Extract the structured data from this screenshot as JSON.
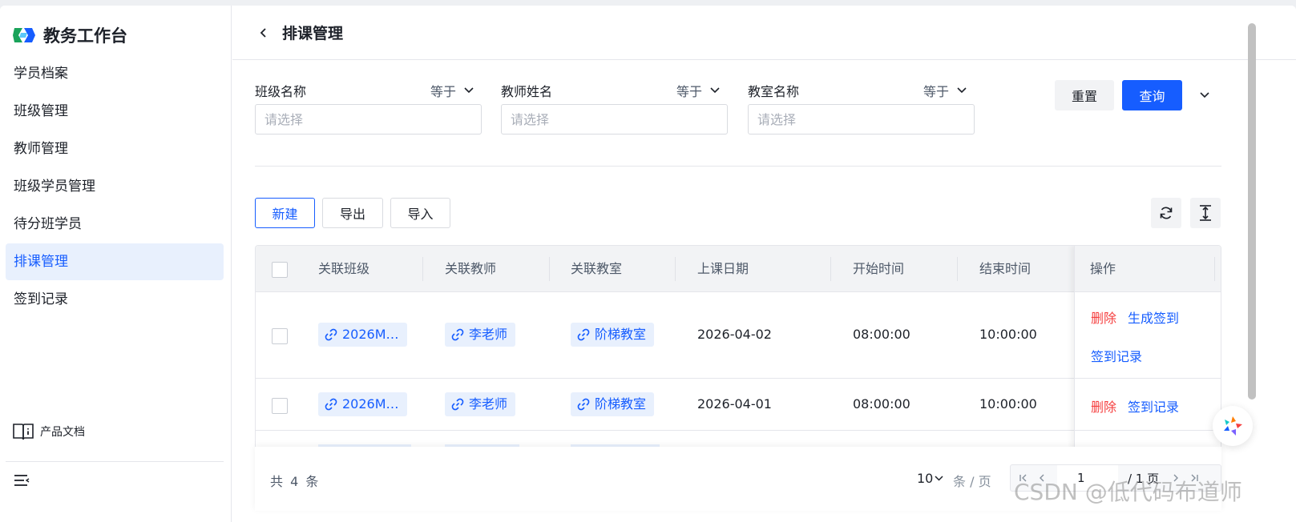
{
  "sidebar": {
    "brand": "教务工作台",
    "items": [
      {
        "label": "学员档案"
      },
      {
        "label": "班级管理"
      },
      {
        "label": "教师管理"
      },
      {
        "label": "班级学员管理"
      },
      {
        "label": "待分班学员"
      },
      {
        "label": "排课管理",
        "active": true
      },
      {
        "label": "签到记录"
      }
    ],
    "docs": "产品文档"
  },
  "header": {
    "title": "排课管理"
  },
  "filters": [
    {
      "label": "班级名称",
      "operator": "等于",
      "placeholder": "请选择"
    },
    {
      "label": "教师姓名",
      "operator": "等于",
      "placeholder": "请选择"
    },
    {
      "label": "教室名称",
      "operator": "等于",
      "placeholder": "请选择"
    }
  ],
  "actions": {
    "reset": "重置",
    "query": "查询"
  },
  "toolbar": {
    "new": "新建",
    "export": "导出",
    "import": "导入"
  },
  "table": {
    "columns": [
      "关联班级",
      "关联教师",
      "关联教室",
      "上课日期",
      "开始时间",
      "结束时间",
      "操作"
    ],
    "rows": [
      {
        "class": "2026M…",
        "teacher": "李老师",
        "room": "阶梯教室",
        "date": "2026-04-02",
        "start": "08:00:00",
        "end": "10:00:00",
        "ops": [
          "删除",
          "生成签到",
          "签到记录"
        ]
      },
      {
        "class": "2026M…",
        "teacher": "李老师",
        "room": "阶梯教室",
        "date": "2026-04-01",
        "start": "08:00:00",
        "end": "10:00:00",
        "ops": [
          "删除",
          "签到记录"
        ]
      }
    ]
  },
  "pagination": {
    "total": "共 4 条",
    "page_size": "10",
    "per_page": "条 / 页",
    "current": "1",
    "of_pages": "/ 1 页"
  },
  "watermark": "CSDN @低代码布道师",
  "colors": {
    "primary": "#165dff",
    "danger": "#f53f3f",
    "active_bg": "#e8f0fd"
  }
}
